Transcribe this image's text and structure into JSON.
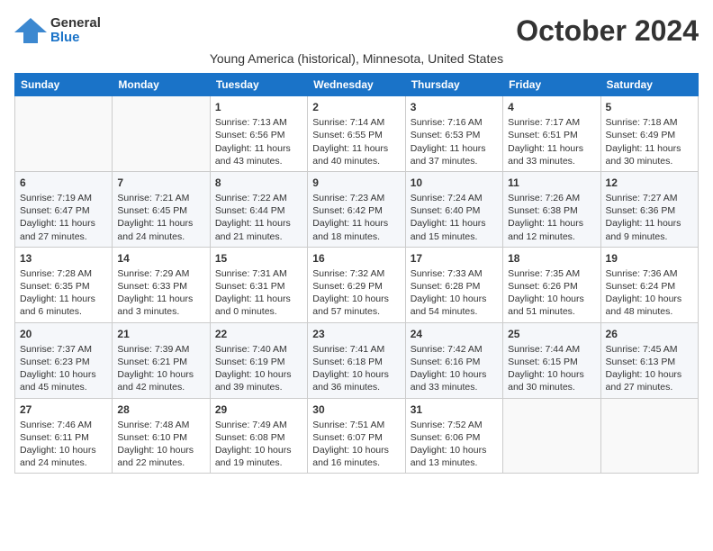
{
  "header": {
    "logo_general": "General",
    "logo_blue": "Blue",
    "month": "October 2024",
    "subtitle": "Young America (historical), Minnesota, United States"
  },
  "days_of_week": [
    "Sunday",
    "Monday",
    "Tuesday",
    "Wednesday",
    "Thursday",
    "Friday",
    "Saturday"
  ],
  "weeks": [
    [
      {
        "day": "",
        "data": ""
      },
      {
        "day": "",
        "data": ""
      },
      {
        "day": "1",
        "data": "Sunrise: 7:13 AM\nSunset: 6:56 PM\nDaylight: 11 hours and 43 minutes."
      },
      {
        "day": "2",
        "data": "Sunrise: 7:14 AM\nSunset: 6:55 PM\nDaylight: 11 hours and 40 minutes."
      },
      {
        "day": "3",
        "data": "Sunrise: 7:16 AM\nSunset: 6:53 PM\nDaylight: 11 hours and 37 minutes."
      },
      {
        "day": "4",
        "data": "Sunrise: 7:17 AM\nSunset: 6:51 PM\nDaylight: 11 hours and 33 minutes."
      },
      {
        "day": "5",
        "data": "Sunrise: 7:18 AM\nSunset: 6:49 PM\nDaylight: 11 hours and 30 minutes."
      }
    ],
    [
      {
        "day": "6",
        "data": "Sunrise: 7:19 AM\nSunset: 6:47 PM\nDaylight: 11 hours and 27 minutes."
      },
      {
        "day": "7",
        "data": "Sunrise: 7:21 AM\nSunset: 6:45 PM\nDaylight: 11 hours and 24 minutes."
      },
      {
        "day": "8",
        "data": "Sunrise: 7:22 AM\nSunset: 6:44 PM\nDaylight: 11 hours and 21 minutes."
      },
      {
        "day": "9",
        "data": "Sunrise: 7:23 AM\nSunset: 6:42 PM\nDaylight: 11 hours and 18 minutes."
      },
      {
        "day": "10",
        "data": "Sunrise: 7:24 AM\nSunset: 6:40 PM\nDaylight: 11 hours and 15 minutes."
      },
      {
        "day": "11",
        "data": "Sunrise: 7:26 AM\nSunset: 6:38 PM\nDaylight: 11 hours and 12 minutes."
      },
      {
        "day": "12",
        "data": "Sunrise: 7:27 AM\nSunset: 6:36 PM\nDaylight: 11 hours and 9 minutes."
      }
    ],
    [
      {
        "day": "13",
        "data": "Sunrise: 7:28 AM\nSunset: 6:35 PM\nDaylight: 11 hours and 6 minutes."
      },
      {
        "day": "14",
        "data": "Sunrise: 7:29 AM\nSunset: 6:33 PM\nDaylight: 11 hours and 3 minutes."
      },
      {
        "day": "15",
        "data": "Sunrise: 7:31 AM\nSunset: 6:31 PM\nDaylight: 11 hours and 0 minutes."
      },
      {
        "day": "16",
        "data": "Sunrise: 7:32 AM\nSunset: 6:29 PM\nDaylight: 10 hours and 57 minutes."
      },
      {
        "day": "17",
        "data": "Sunrise: 7:33 AM\nSunset: 6:28 PM\nDaylight: 10 hours and 54 minutes."
      },
      {
        "day": "18",
        "data": "Sunrise: 7:35 AM\nSunset: 6:26 PM\nDaylight: 10 hours and 51 minutes."
      },
      {
        "day": "19",
        "data": "Sunrise: 7:36 AM\nSunset: 6:24 PM\nDaylight: 10 hours and 48 minutes."
      }
    ],
    [
      {
        "day": "20",
        "data": "Sunrise: 7:37 AM\nSunset: 6:23 PM\nDaylight: 10 hours and 45 minutes."
      },
      {
        "day": "21",
        "data": "Sunrise: 7:39 AM\nSunset: 6:21 PM\nDaylight: 10 hours and 42 minutes."
      },
      {
        "day": "22",
        "data": "Sunrise: 7:40 AM\nSunset: 6:19 PM\nDaylight: 10 hours and 39 minutes."
      },
      {
        "day": "23",
        "data": "Sunrise: 7:41 AM\nSunset: 6:18 PM\nDaylight: 10 hours and 36 minutes."
      },
      {
        "day": "24",
        "data": "Sunrise: 7:42 AM\nSunset: 6:16 PM\nDaylight: 10 hours and 33 minutes."
      },
      {
        "day": "25",
        "data": "Sunrise: 7:44 AM\nSunset: 6:15 PM\nDaylight: 10 hours and 30 minutes."
      },
      {
        "day": "26",
        "data": "Sunrise: 7:45 AM\nSunset: 6:13 PM\nDaylight: 10 hours and 27 minutes."
      }
    ],
    [
      {
        "day": "27",
        "data": "Sunrise: 7:46 AM\nSunset: 6:11 PM\nDaylight: 10 hours and 24 minutes."
      },
      {
        "day": "28",
        "data": "Sunrise: 7:48 AM\nSunset: 6:10 PM\nDaylight: 10 hours and 22 minutes."
      },
      {
        "day": "29",
        "data": "Sunrise: 7:49 AM\nSunset: 6:08 PM\nDaylight: 10 hours and 19 minutes."
      },
      {
        "day": "30",
        "data": "Sunrise: 7:51 AM\nSunset: 6:07 PM\nDaylight: 10 hours and 16 minutes."
      },
      {
        "day": "31",
        "data": "Sunrise: 7:52 AM\nSunset: 6:06 PM\nDaylight: 10 hours and 13 minutes."
      },
      {
        "day": "",
        "data": ""
      },
      {
        "day": "",
        "data": ""
      }
    ]
  ]
}
